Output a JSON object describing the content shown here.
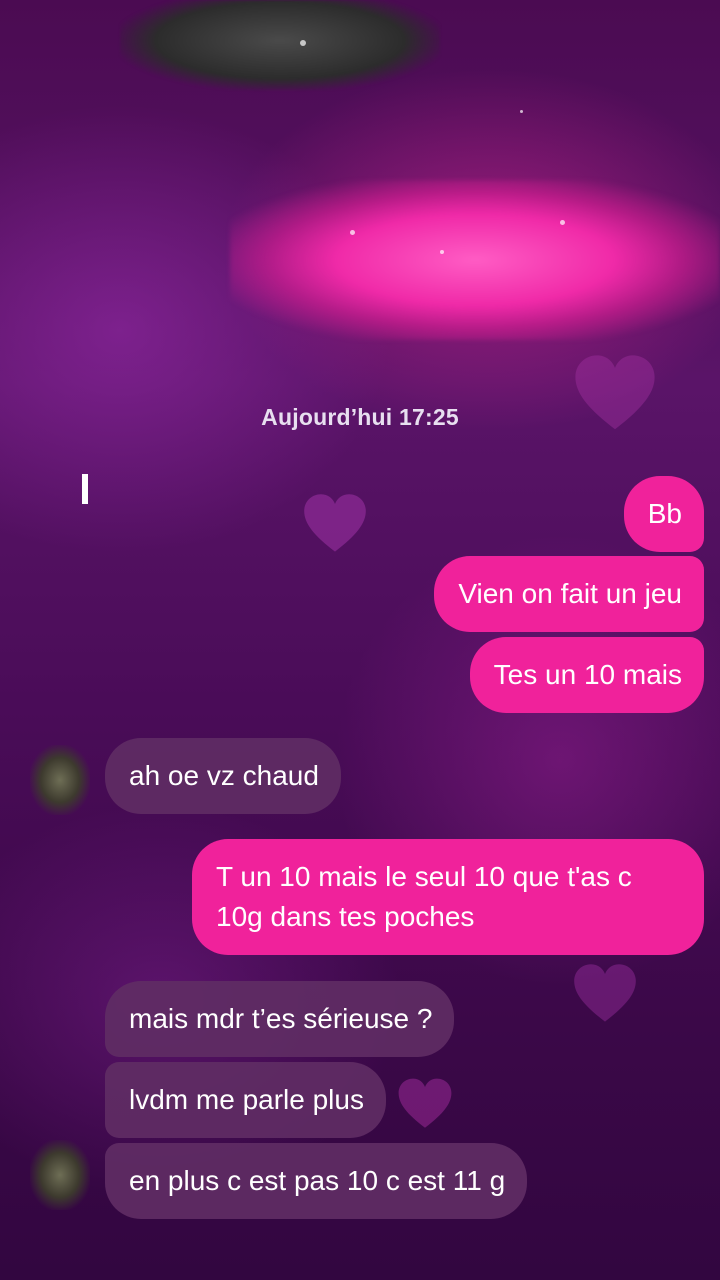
{
  "conversation": {
    "timestamp": "Aujourd’hui 17:25",
    "messages": [
      {
        "direction": "sent",
        "text": "Bb"
      },
      {
        "direction": "sent",
        "text": "Vien on fait un jeu"
      },
      {
        "direction": "sent",
        "text": "Tes un 10 mais"
      },
      {
        "direction": "received",
        "text": "ah oe vz chaud"
      },
      {
        "direction": "sent",
        "text": "T un 10 mais le seul 10 que t'as c 10g dans tes poches"
      },
      {
        "direction": "received",
        "text": "mais mdr t’es sérieuse ?"
      },
      {
        "direction": "received",
        "text": "lvdm me parle plus"
      },
      {
        "direction": "received",
        "text": "en plus c est pas 10 c est 11 g"
      }
    ]
  },
  "colors": {
    "sent_bubble": "#f0229b",
    "received_bubble": "#5f2d64",
    "background": "#4b0b52"
  },
  "icons": [
    "heart-icon"
  ]
}
